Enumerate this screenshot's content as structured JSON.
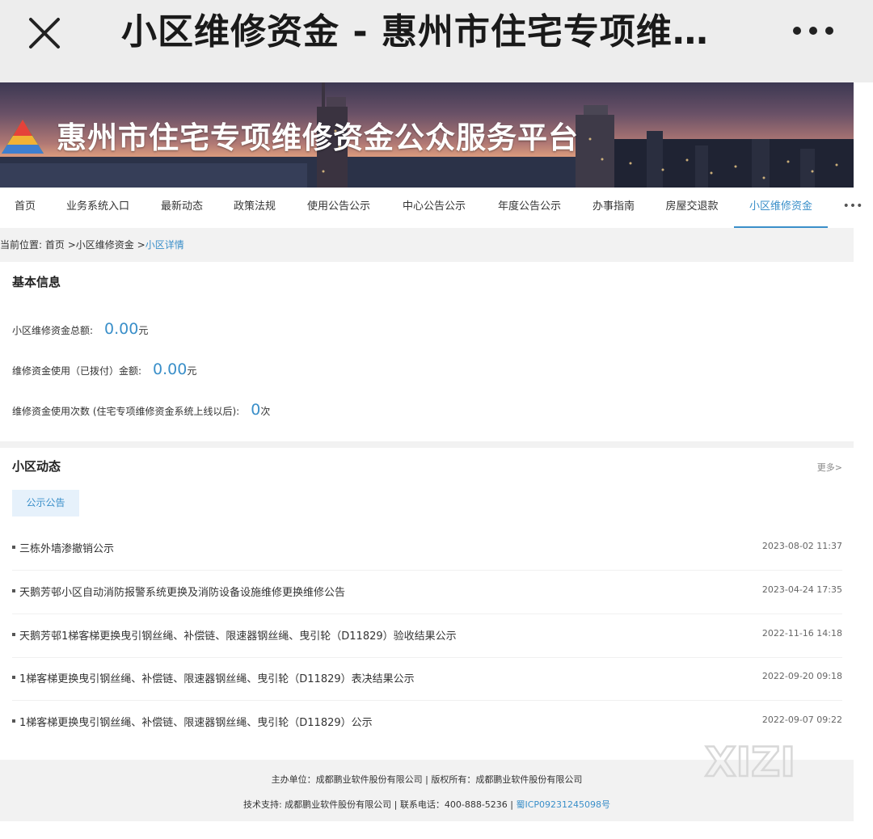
{
  "browser": {
    "title": "小区维修资金 - 惠州市住宅专项维…",
    "close_icon": "close-icon",
    "more_icon": "more-horizontal-icon"
  },
  "banner": {
    "title": "惠州市住宅专项维修资金公众服务平台",
    "logo_icon": "pyramid-logo-icon"
  },
  "nav": {
    "items": [
      "首页",
      "业务系统入口",
      "最新动态",
      "政策法规",
      "使用公告公示",
      "中心公告公示",
      "年度公告公示",
      "办事指南",
      "房屋交退款",
      "小区维修资金"
    ],
    "active": "小区维修资金",
    "more": "•••"
  },
  "breadcrumb": {
    "prefix": "当前位置:",
    "home": "首页",
    "sep1": ">",
    "level1": "小区维修资金",
    "sep2": ">",
    "current": "小区详情"
  },
  "basic_info": {
    "title": "基本信息",
    "rows": [
      {
        "label": "小区维修资金总额:",
        "value": "0.00",
        "unit": "元"
      },
      {
        "label": "维修资金使用（已拨付）金额:",
        "value": "0.00",
        "unit": "元"
      },
      {
        "label": "维修资金使用次数 (住宅专项维修资金系统上线以后):",
        "value": "0",
        "unit": "次"
      }
    ]
  },
  "news": {
    "title": "小区动态",
    "more": "更多>",
    "tab": "公示公告",
    "items": [
      {
        "title": "三栋外墙渗撤销公示",
        "date": "2023-08-02 11:37"
      },
      {
        "title": "天鹅芳邨小区自动消防报警系统更换及消防设备设施维修更换维修公告",
        "date": "2023-04-24 17:35"
      },
      {
        "title": "天鹅芳邨1梯客梯更换曳引钢丝绳、补偿链、限速器钢丝绳、曳引轮（D11829）验收结果公示",
        "date": "2022-11-16 14:18"
      },
      {
        "title": "1梯客梯更换曳引钢丝绳、补偿链、限速器钢丝绳、曳引轮（D11829）表决结果公示",
        "date": "2022-09-20 09:18"
      },
      {
        "title": "1梯客梯更换曳引钢丝绳、补偿链、限速器钢丝绳、曳引轮（D11829）公示",
        "date": "2022-09-07 09:22"
      }
    ]
  },
  "footer": {
    "line1": "主办单位：成都鹏业软件股份有限公司 | 版权所有：成都鹏业软件股份有限公司",
    "line2_text": "技术支持: 成都鹏业软件股份有限公司 | 联系电话：400-888-5236 | ",
    "icp": "蜀ICP09231245098号"
  },
  "watermark": {
    "text": "XIZI"
  },
  "colors": {
    "accent": "#3a8fc9",
    "bar_bg": "#ededed",
    "page_bg": "#f2f2f2"
  }
}
